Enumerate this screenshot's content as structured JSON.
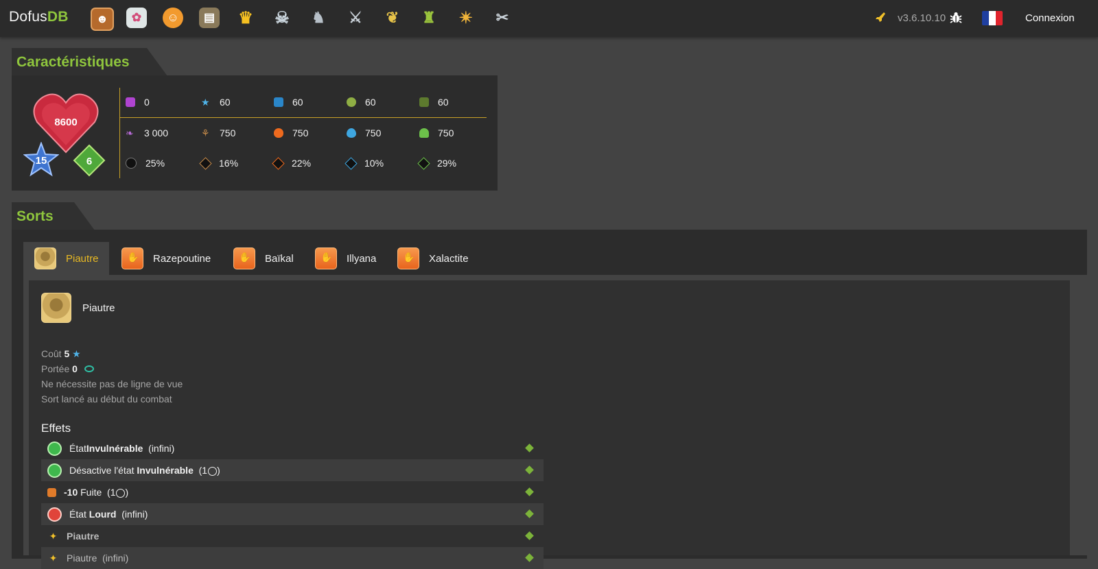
{
  "header": {
    "logo_part1": "Dofus",
    "logo_part2": "DB",
    "nav_icons": [
      "monsters-icon",
      "npc-icon",
      "characters-icon",
      "items-icon",
      "achievements-icon",
      "dungeons-icon",
      "almanax-icon",
      "weapons-icon",
      "resources-icon",
      "equipment-icon",
      "spells-icon",
      "tools-icon"
    ],
    "version": "v3.6.10.10",
    "login_label": "Connexion",
    "colors": {
      "accent": "#8fc63d",
      "background": "#434343",
      "topbar": "#2b2b2b",
      "gold": "#c9a227"
    }
  },
  "caracteristiques": {
    "title": "Caractéristiques",
    "life": "8600",
    "level": "15",
    "level_gem": "6",
    "rows": [
      [
        "0",
        "60",
        "60",
        "60",
        "60"
      ],
      [
        "3 000",
        "750",
        "750",
        "750",
        "750"
      ],
      [
        "25%",
        "16%",
        "22%",
        "10%",
        "29%"
      ]
    ],
    "row_icons": [
      [
        "pm-icon",
        "ap-star-icon",
        "shield-star-icon",
        "tackle-icon",
        "escape-icon"
      ],
      [
        "summon-icon",
        "earth-icon",
        "fire-icon",
        "water-icon",
        "air-icon"
      ],
      [
        "neutral-resist-icon",
        "earth-resist-icon",
        "fire-resist-icon",
        "water-resist-icon",
        "air-resist-icon"
      ]
    ]
  },
  "sorts": {
    "title": "Sorts",
    "tabs": [
      "Piautre",
      "Razepoutine",
      "Baïkal",
      "Illyana",
      "Xalactite"
    ],
    "active_tab": "Piautre",
    "detail": {
      "name": "Piautre",
      "cost_label": "Coût",
      "cost_value": "5",
      "range_label": "Portée",
      "range_value": "0",
      "line_of_sight": "Ne nécessite pas de ligne de vue",
      "cast_info": "Sort lancé au début du combat",
      "effects_title": "Effets",
      "effects": [
        {
          "pre": "État ",
          "bold": "Invulnérable",
          "post": "  (infini)"
        },
        {
          "pre": "Désactive l'état ",
          "bold": "Invulnérable",
          "post": "  (1"
        },
        {
          "pre": "",
          "bold": "-10",
          "post": " Fuite  (1"
        },
        {
          "pre": "État ",
          "bold": "Lourd",
          "post": "  (infini)"
        },
        {
          "pre": "",
          "bold": "Piautre",
          "post": ""
        },
        {
          "pre": "",
          "bold": "",
          "post": "Piautre  (infini)"
        }
      ]
    }
  }
}
